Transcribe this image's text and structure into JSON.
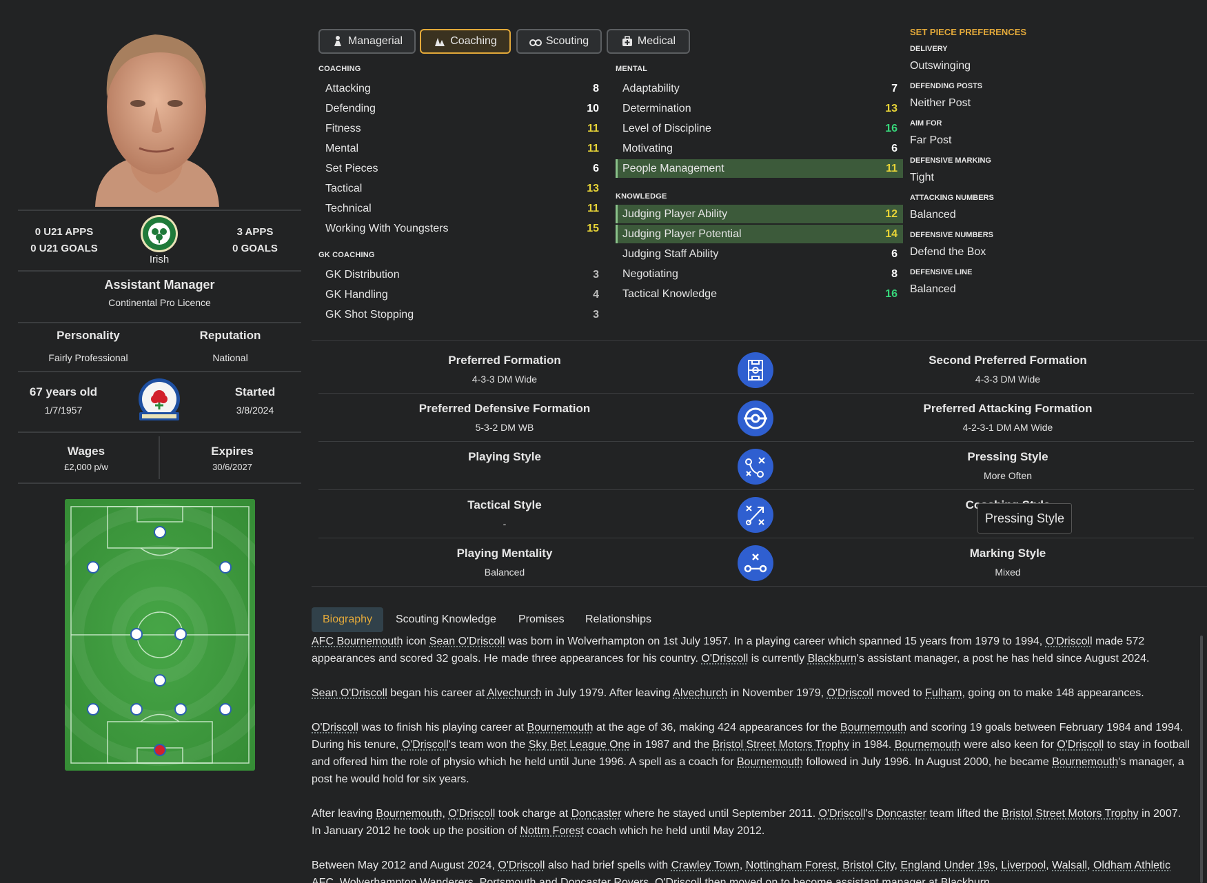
{
  "profile": {
    "u21_apps": "0 U21 APPS",
    "u21_goals": "0 U21 GOALS",
    "nation": "Irish",
    "apps": "3 APPS",
    "goals": "0 GOALS",
    "role": "Assistant Manager",
    "licence": "Continental Pro Licence",
    "personality_label": "Personality",
    "personality": "Fairly Professional",
    "reputation_label": "Reputation",
    "reputation": "National",
    "age": "67 years old",
    "dob": "1/7/1957",
    "started_label": "Started",
    "started": "3/8/2024",
    "wages_label": "Wages",
    "wages": "£2,000 p/w",
    "expires_label": "Expires",
    "expires": "30/6/2027"
  },
  "tabs": [
    {
      "label": "Managerial",
      "icon": "manager-icon"
    },
    {
      "label": "Coaching",
      "icon": "coaching-icon"
    },
    {
      "label": "Scouting",
      "icon": "binoculars-icon"
    },
    {
      "label": "Medical",
      "icon": "medical-kit-icon"
    }
  ],
  "coaching": {
    "title": "COACHING",
    "rows": [
      {
        "label": "Attacking",
        "value": "8"
      },
      {
        "label": "Defending",
        "value": "10"
      },
      {
        "label": "Fitness",
        "value": "11"
      },
      {
        "label": "Mental",
        "value": "11"
      },
      {
        "label": "Set Pieces",
        "value": "6"
      },
      {
        "label": "Tactical",
        "value": "13"
      },
      {
        "label": "Technical",
        "value": "11"
      },
      {
        "label": "Working With Youngsters",
        "value": "15"
      }
    ]
  },
  "gk": {
    "title": "GK COACHING",
    "rows": [
      {
        "label": "GK Distribution",
        "value": "3"
      },
      {
        "label": "GK Handling",
        "value": "4"
      },
      {
        "label": "GK Shot Stopping",
        "value": "3"
      }
    ]
  },
  "mental": {
    "title": "MENTAL",
    "rows": [
      {
        "label": "Adaptability",
        "value": "7"
      },
      {
        "label": "Determination",
        "value": "13"
      },
      {
        "label": "Level of Discipline",
        "value": "16"
      },
      {
        "label": "Motivating",
        "value": "6"
      },
      {
        "label": "People Management",
        "value": "11"
      }
    ]
  },
  "knowledge": {
    "title": "KNOWLEDGE",
    "rows": [
      {
        "label": "Judging Player Ability",
        "value": "12"
      },
      {
        "label": "Judging Player Potential",
        "value": "14"
      },
      {
        "label": "Judging Staff Ability",
        "value": "6"
      },
      {
        "label": "Negotiating",
        "value": "8"
      },
      {
        "label": "Tactical Knowledge",
        "value": "16"
      }
    ]
  },
  "set_pieces": {
    "title": "SET PIECE PREFERENCES",
    "items": [
      {
        "label": "DELIVERY",
        "value": "Outswinging"
      },
      {
        "label": "DEFENDING POSTS",
        "value": "Neither Post"
      },
      {
        "label": "AIM FOR",
        "value": "Far Post"
      },
      {
        "label": "DEFENSIVE MARKING",
        "value": "Tight"
      },
      {
        "label": "ATTACKING NUMBERS",
        "value": "Balanced"
      },
      {
        "label": "DEFENSIVE NUMBERS",
        "value": "Defend the Box"
      },
      {
        "label": "DEFENSIVE LINE",
        "value": "Balanced"
      }
    ]
  },
  "formations": [
    {
      "left_label": "Preferred Formation",
      "left_value": "4-3-3 DM Wide",
      "right_label": "Second Preferred Formation",
      "right_value": "4-3-3 DM Wide",
      "icon": "pitch-icon"
    },
    {
      "left_label": "Preferred Defensive Formation",
      "left_value": "5-3-2 DM WB",
      "right_label": "Preferred Attacking Formation",
      "right_value": "4-2-3-1 DM AM Wide",
      "icon": "target-icon"
    },
    {
      "left_label": "Playing Style",
      "left_value": "",
      "right_label": "Pressing Style",
      "right_value": "More Often",
      "icon": "tactics-icon"
    },
    {
      "left_label": "Tactical Style",
      "left_value": "-",
      "right_label": "Coaching Style",
      "right_value": "",
      "icon": "tactics-arrow-icon"
    },
    {
      "left_label": "Playing Mentality",
      "left_value": "Balanced",
      "right_label": "Marking Style",
      "right_value": "Mixed",
      "icon": "play-icon"
    }
  ],
  "tooltip": "Pressing Style",
  "bottom_tabs": [
    "Biography",
    "Scouting Knowledge",
    "Promises",
    "Relationships"
  ],
  "bio": {
    "p1": [
      {
        "t": "AFC Bournemouth",
        "link": true
      },
      {
        "t": " icon "
      },
      {
        "t": "Sean O'Driscoll",
        "link": true
      },
      {
        "t": " was born in Wolverhampton on 1st July 1957. In a playing career which spanned 15 years from 1979 to 1994, "
      },
      {
        "t": "O'Driscoll",
        "link": true
      },
      {
        "t": " made 572 appearances and scored 32 goals. He made three appearances for his country. "
      },
      {
        "t": "O'Driscoll",
        "link": true
      },
      {
        "t": " is currently "
      },
      {
        "t": "Blackburn",
        "link": true
      },
      {
        "t": "'s assistant manager, a post he has held since August 2024."
      }
    ],
    "p2": [
      {
        "t": "Sean O'Driscoll",
        "link": true
      },
      {
        "t": " began his career at "
      },
      {
        "t": "Alvechurch",
        "link": true
      },
      {
        "t": " in July 1979. After leaving "
      },
      {
        "t": "Alvechurch",
        "link": true
      },
      {
        "t": " in November 1979, "
      },
      {
        "t": "O'Driscoll",
        "link": true
      },
      {
        "t": " moved to "
      },
      {
        "t": "Fulham",
        "link": true
      },
      {
        "t": ", going on to make 148 appearances."
      }
    ],
    "p3": [
      {
        "t": "O'Driscoll",
        "link": true
      },
      {
        "t": " was to finish his playing career at "
      },
      {
        "t": "Bournemouth",
        "link": true
      },
      {
        "t": " at the age of 36, making 424 appearances for the "
      },
      {
        "t": "Bournemouth",
        "link": true
      },
      {
        "t": " and scoring 19 goals between February 1984 and 1994. During his tenure, "
      },
      {
        "t": "O'Driscoll",
        "link": true
      },
      {
        "t": "'s team won the "
      },
      {
        "t": "Sky Bet League One",
        "link": true
      },
      {
        "t": " in 1987 and the "
      },
      {
        "t": "Bristol Street Motors Trophy",
        "link": true
      },
      {
        "t": " in 1984. "
      },
      {
        "t": "Bournemouth",
        "link": true
      },
      {
        "t": " were also keen for "
      },
      {
        "t": "O'Driscoll",
        "link": true
      },
      {
        "t": " to stay in football and offered him the role of physio which he held until June 1996. A spell as a coach for "
      },
      {
        "t": "Bournemouth",
        "link": true
      },
      {
        "t": " followed in July 1996. In August 2000, he became "
      },
      {
        "t": "Bournemouth",
        "link": true
      },
      {
        "t": "'s manager, a post he would hold for six years."
      }
    ],
    "p4": [
      {
        "t": "After leaving "
      },
      {
        "t": "Bournemouth",
        "link": true
      },
      {
        "t": ", "
      },
      {
        "t": "O'Driscoll",
        "link": true
      },
      {
        "t": " took charge at "
      },
      {
        "t": "Doncaster",
        "link": true
      },
      {
        "t": " where he stayed until September 2011. "
      },
      {
        "t": "O'Driscoll",
        "link": true
      },
      {
        "t": "'s "
      },
      {
        "t": "Doncaster",
        "link": true
      },
      {
        "t": " team lifted the "
      },
      {
        "t": "Bristol Street Motors Trophy",
        "link": true
      },
      {
        "t": " in 2007. In January 2012 he took up the position of "
      },
      {
        "t": "Nottm Forest",
        "link": true
      },
      {
        "t": " coach which he held until May 2012."
      }
    ],
    "p5": [
      {
        "t": "Between May 2012 and August 2024, "
      },
      {
        "t": "O'Driscoll",
        "link": true
      },
      {
        "t": " also had brief spells with "
      },
      {
        "t": "Crawley Town",
        "link": true
      },
      {
        "t": ", "
      },
      {
        "t": "Nottingham Forest",
        "link": true
      },
      {
        "t": ", "
      },
      {
        "t": "Bristol City",
        "link": true
      },
      {
        "t": ", "
      },
      {
        "t": "England Under 19s",
        "link": true
      },
      {
        "t": ", "
      },
      {
        "t": "Liverpool",
        "link": true
      },
      {
        "t": ", "
      },
      {
        "t": "Walsall",
        "link": true
      },
      {
        "t": ", "
      },
      {
        "t": "Oldham Athletic AFC",
        "link": true
      },
      {
        "t": ", "
      },
      {
        "t": "Wolverhampton Wanderers",
        "link": true
      },
      {
        "t": ", "
      },
      {
        "t": "Portsmouth",
        "link": true
      },
      {
        "t": " and "
      },
      {
        "t": "Doncaster Rovers",
        "link": true
      },
      {
        "t": ". O'Driscoll then moved on to become assistant manager at "
      },
      {
        "t": "Blackburn",
        "link": true
      },
      {
        "t": "."
      }
    ]
  },
  "colors": {
    "accent": "#e3a93a",
    "high": "#37d67a",
    "mid": "#e6d337",
    "icon_bg": "#2f5fd0"
  }
}
